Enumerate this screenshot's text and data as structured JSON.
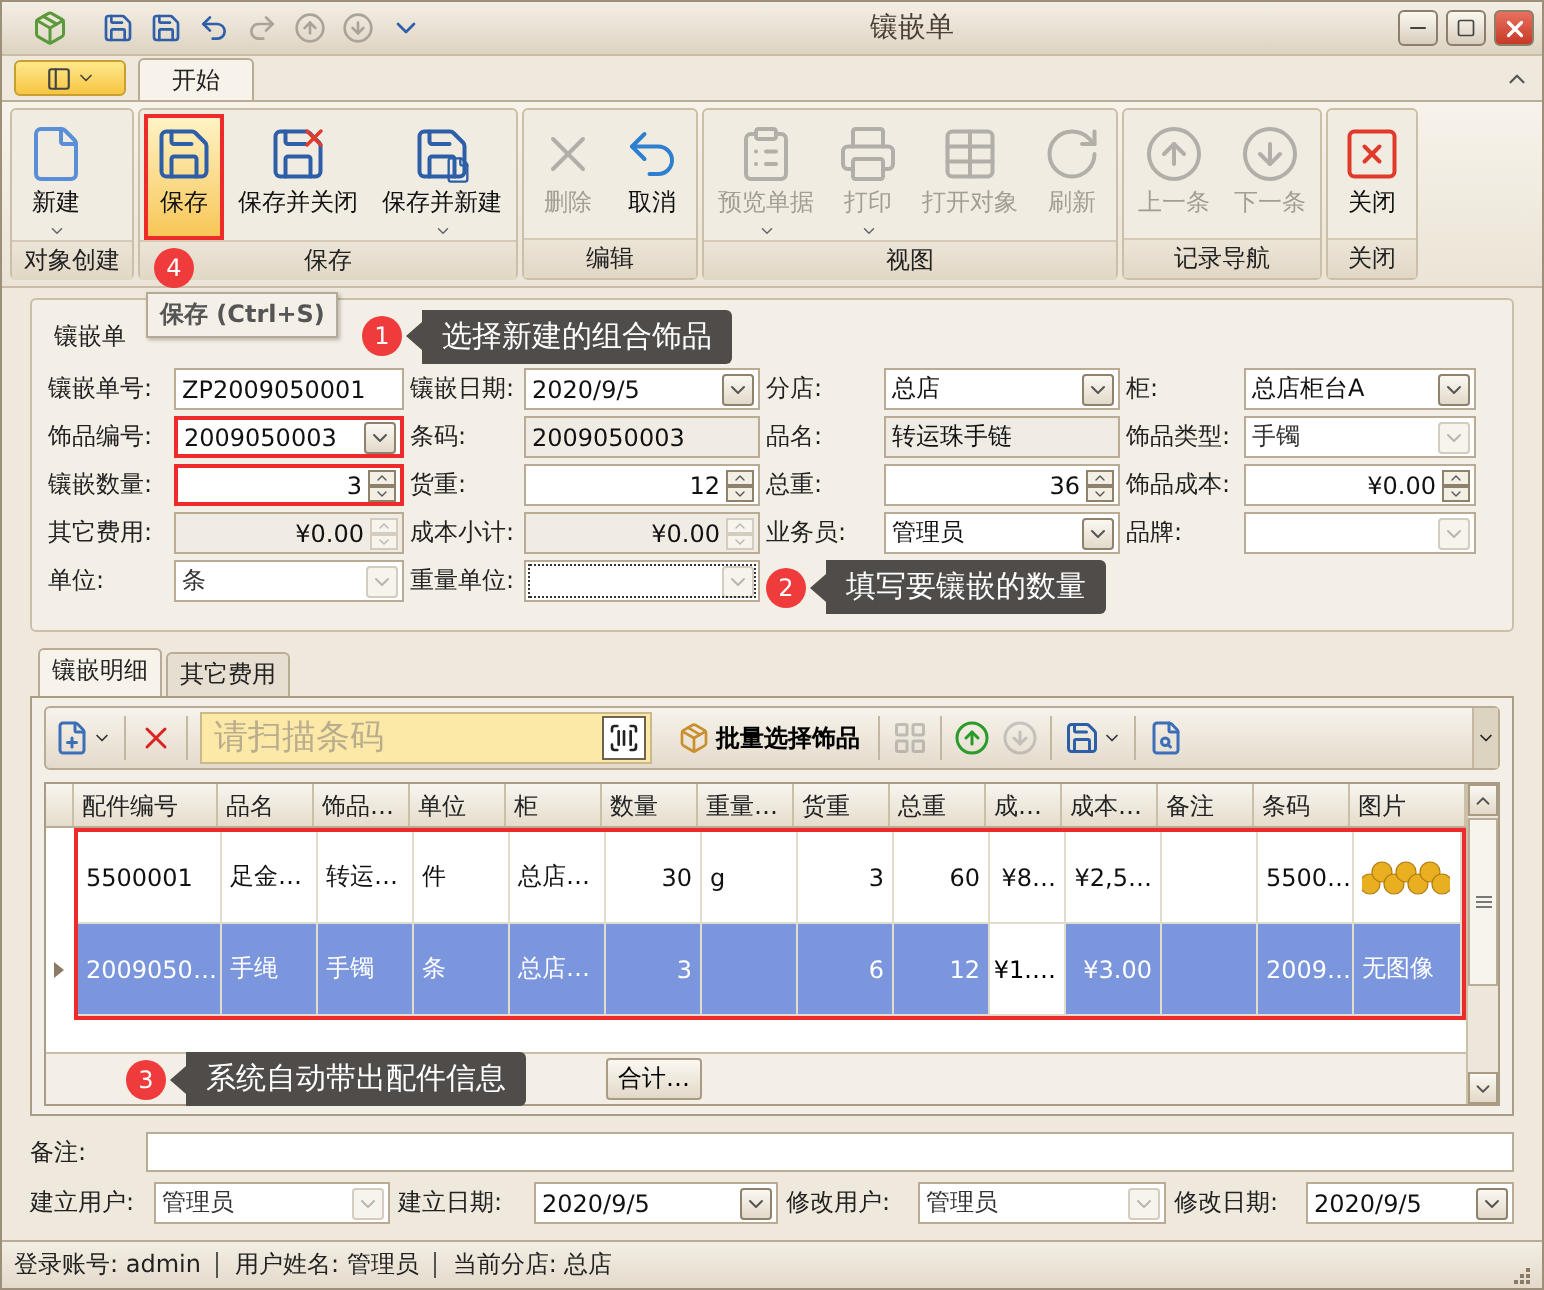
{
  "window": {
    "title": "镶嵌单"
  },
  "quick_access": [
    {
      "kind": "save",
      "disabled": false
    },
    {
      "kind": "save_close",
      "disabled": false
    },
    {
      "kind": "undo",
      "disabled": false
    },
    {
      "kind": "redo",
      "disabled": true
    },
    {
      "kind": "up",
      "disabled": true
    },
    {
      "kind": "down",
      "disabled": true
    },
    {
      "kind": "customize",
      "disabled": false
    }
  ],
  "ribbon": {
    "tabs": [
      {
        "label": "开始",
        "selected": true
      }
    ],
    "groups": [
      {
        "label": "对象创建",
        "buttons": [
          {
            "label": "新建",
            "kind": "new",
            "disabled": false,
            "dropdown": true,
            "highlighted": false
          }
        ]
      },
      {
        "label": "保存",
        "buttons": [
          {
            "label": "保存",
            "kind": "save",
            "disabled": false,
            "dropdown": false,
            "highlighted": true
          },
          {
            "label": "保存并关闭",
            "kind": "save_close",
            "disabled": false,
            "dropdown": false,
            "highlighted": false
          },
          {
            "label": "保存并新建",
            "kind": "save_new",
            "disabled": false,
            "dropdown": true,
            "highlighted": false
          }
        ]
      },
      {
        "label": "编辑",
        "buttons": [
          {
            "label": "删除",
            "kind": "delete",
            "disabled": true,
            "dropdown": false,
            "highlighted": false
          },
          {
            "label": "取消",
            "kind": "cancel",
            "disabled": false,
            "dropdown": false,
            "highlighted": false
          }
        ]
      },
      {
        "label": "视图",
        "buttons": [
          {
            "label": "预览单据",
            "kind": "preview",
            "disabled": true,
            "dropdown": true,
            "highlighted": false
          },
          {
            "label": "打印",
            "kind": "print",
            "disabled": true,
            "dropdown": true,
            "highlighted": false
          },
          {
            "label": "打开对象",
            "kind": "open",
            "disabled": true,
            "dropdown": false,
            "highlighted": false
          },
          {
            "label": "刷新",
            "kind": "refresh",
            "disabled": true,
            "dropdown": false,
            "highlighted": false
          }
        ]
      },
      {
        "label": "记录导航",
        "buttons": [
          {
            "label": "上一条",
            "kind": "prev",
            "disabled": true,
            "dropdown": false,
            "highlighted": false
          },
          {
            "label": "下一条",
            "kind": "next",
            "disabled": true,
            "dropdown": false,
            "highlighted": false
          }
        ]
      },
      {
        "label": "关闭",
        "buttons": [
          {
            "label": "关闭",
            "kind": "close",
            "disabled": false,
            "dropdown": false,
            "highlighted": false
          }
        ]
      }
    ]
  },
  "tooltip": {
    "text": "保存 (Ctrl+S)"
  },
  "callouts": [
    {
      "number": "1",
      "text": "选择新建的组合饰品"
    },
    {
      "number": "2",
      "text": "填写要镶嵌的数量"
    },
    {
      "number": "3",
      "text": "系统自动带出配件信息"
    },
    {
      "number": "4"
    }
  ],
  "form": {
    "title": "镶嵌单",
    "rows": [
      [
        {
          "label": "镶嵌单号:",
          "value": "ZP2009050001",
          "kind": "text",
          "disabled": false,
          "highlighted": false,
          "focused": false
        },
        {
          "label": "镶嵌日期:",
          "value": "2020/9/5",
          "kind": "combo",
          "disabled": false,
          "highlighted": false,
          "focused": false
        },
        {
          "label": "分店:",
          "value": "总店",
          "kind": "combo",
          "disabled": false,
          "highlighted": false,
          "focused": false
        },
        {
          "label": "柜:",
          "value": "总店柜台A",
          "kind": "combo",
          "disabled": false,
          "highlighted": false,
          "focused": false
        }
      ],
      [
        {
          "label": "饰品编号:",
          "value": "2009050003",
          "kind": "combo",
          "disabled": false,
          "highlighted": true,
          "focused": false
        },
        {
          "label": "条码:",
          "value": "2009050003",
          "kind": "text",
          "disabled": true,
          "highlighted": false,
          "focused": false
        },
        {
          "label": "品名:",
          "value": "转运珠手链",
          "kind": "text",
          "disabled": true,
          "highlighted": false,
          "focused": false
        },
        {
          "label": "饰品类型:",
          "value": "手镯",
          "kind": "combo",
          "disabled": true,
          "highlighted": false,
          "focused": false
        }
      ],
      [
        {
          "label": "镶嵌数量:",
          "value": "3",
          "kind": "spin",
          "disabled": false,
          "highlighted": true,
          "focused": false
        },
        {
          "label": "货重:",
          "value": "12",
          "kind": "spin",
          "disabled": false,
          "highlighted": false,
          "focused": false
        },
        {
          "label": "总重:",
          "value": "36",
          "kind": "spin",
          "disabled": false,
          "highlighted": false,
          "focused": false
        },
        {
          "label": "饰品成本:",
          "value": "¥0.00",
          "kind": "spin",
          "disabled": false,
          "highlighted": false,
          "focused": false
        }
      ],
      [
        {
          "label": "其它费用:",
          "value": "¥0.00",
          "kind": "spin",
          "disabled": true,
          "highlighted": false,
          "focused": false
        },
        {
          "label": "成本小计:",
          "value": "¥0.00",
          "kind": "spin",
          "disabled": true,
          "highlighted": false,
          "focused": false
        },
        {
          "label": "业务员:",
          "value": "管理员",
          "kind": "combo",
          "disabled": false,
          "highlighted": false,
          "focused": false
        },
        {
          "label": "品牌:",
          "kind": "combo",
          "disabled": true,
          "highlighted": false,
          "focused": false
        }
      ],
      [
        {
          "label": "单位:",
          "value": "条",
          "kind": "combo",
          "disabled": true,
          "highlighted": false,
          "focused": false
        },
        {
          "label": "重量单位:",
          "kind": "combo",
          "disabled": true,
          "highlighted": false,
          "focused": true
        }
      ]
    ]
  },
  "detail_tabs": [
    {
      "label": "镶嵌明细",
      "selected": true
    },
    {
      "label": "其它费用",
      "selected": false
    }
  ],
  "toolbar": {
    "leading": [
      {
        "kind": "new",
        "dropdown": true,
        "disabled": false
      },
      {
        "kind": "delete",
        "dropdown": false,
        "disabled": false
      }
    ],
    "search": {
      "placeholder": "请扫描条码"
    },
    "batch_button": {
      "label": "批量选择饰品"
    },
    "trailing": [
      {
        "kind": "grid",
        "dropdown": false,
        "disabled": true
      },
      {
        "kind": "up",
        "dropdown": false,
        "disabled": false
      },
      {
        "kind": "down",
        "dropdown": false,
        "disabled": true
      },
      {
        "kind": "save",
        "dropdown": true,
        "disabled": false
      },
      {
        "kind": "find",
        "dropdown": false,
        "disabled": false
      }
    ]
  },
  "table": {
    "highlighted": true,
    "columns": [
      {
        "label": "配件编号",
        "numeric": false
      },
      {
        "label": "品名",
        "numeric": false
      },
      {
        "label": "饰品…",
        "numeric": false
      },
      {
        "label": "单位",
        "numeric": false
      },
      {
        "label": "柜",
        "numeric": false
      },
      {
        "label": "数量",
        "numeric": true
      },
      {
        "label": "重量…",
        "numeric": false
      },
      {
        "label": "货重",
        "numeric": true
      },
      {
        "label": "总重",
        "numeric": true
      },
      {
        "label": "成…",
        "numeric": true
      },
      {
        "label": "成本…",
        "numeric": true
      },
      {
        "label": "备注"
      },
      {
        "label": "条码",
        "numeric": false
      },
      {
        "label": "图片",
        "numeric": false
      }
    ],
    "rows": [
      {
        "selected": false,
        "cells": [
          "5500001",
          "足金…",
          "转运…",
          "件",
          "总店…",
          "30",
          "g",
          "3",
          "60",
          "¥8…",
          "¥2,5…",
          null,
          "5500…"
        ],
        "image": {
          "kind": "picture"
        }
      },
      {
        "selected": true,
        "cells": [
          "2009050…",
          "手绳",
          "手镯",
          "条",
          "总店…",
          "3",
          null,
          "6",
          "12",
          {
            "text": "¥1.…",
            "focused": true
          },
          "¥3.00",
          null,
          "2009…"
        ],
        "image": {
          "kind": "text",
          "text": "无图像"
        }
      }
    ],
    "total_button": "合计…"
  },
  "remark": {
    "label": "备注:"
  },
  "footer_fields": [
    {
      "label": "建立用户:",
      "value": "管理员",
      "disabled": true
    },
    {
      "label": "建立日期:",
      "value": "2020/9/5",
      "disabled": false
    },
    {
      "label": "修改用户:",
      "value": "管理员",
      "disabled": true
    },
    {
      "label": "修改日期:",
      "value": "2020/9/5",
      "disabled": false
    }
  ],
  "status_bar": [
    "登录账号: admin",
    "用户姓名: 管理员",
    "当前分店: 总店"
  ]
}
